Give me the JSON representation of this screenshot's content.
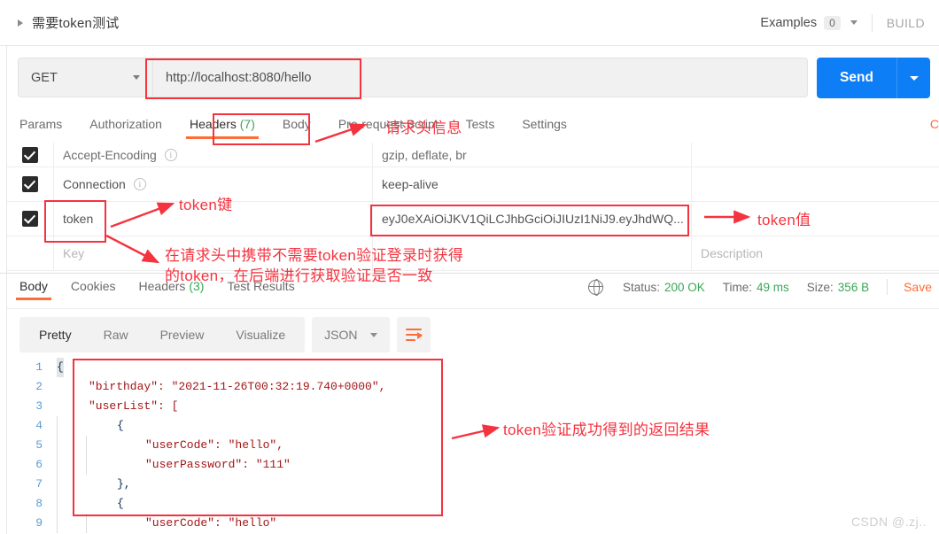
{
  "header": {
    "request_title": "需要token测试",
    "examples_label": "Examples",
    "examples_count": "0",
    "build_label": "BUILD"
  },
  "url_bar": {
    "method": "GET",
    "url": "http://localhost:8080/hello",
    "send_label": "Send"
  },
  "request_tabs": [
    {
      "label": "Params",
      "count": "",
      "active": false
    },
    {
      "label": "Authorization",
      "count": "",
      "active": false
    },
    {
      "label": "Headers",
      "count": "(7)",
      "active": true
    },
    {
      "label": "Body",
      "count": "",
      "active": false
    },
    {
      "label": "Pre-request Script",
      "count": "",
      "active": false
    },
    {
      "label": "Tests",
      "count": "",
      "active": false
    },
    {
      "label": "Settings",
      "count": "",
      "active": false
    }
  ],
  "request_tab_cut_label": "C",
  "headers_table": {
    "rows": [
      {
        "checked": true,
        "key": "Accept-Encoding",
        "has_info": true,
        "value": "gzip, deflate, br",
        "description": ""
      },
      {
        "checked": true,
        "key": "Connection",
        "has_info": true,
        "value": "keep-alive",
        "description": ""
      },
      {
        "checked": true,
        "key": "token",
        "has_info": false,
        "value": "eyJ0eXAiOiJKV1QiLCJhbGciOiJIUzI1NiJ9.eyJhdWQ...",
        "description": ""
      }
    ],
    "new_row": {
      "key_placeholder": "Key",
      "value_placeholder": "",
      "description_placeholder": "Description"
    }
  },
  "response_tabs": [
    {
      "label": "Body",
      "count": "",
      "active": true
    },
    {
      "label": "Cookies",
      "count": "",
      "active": false
    },
    {
      "label": "Headers",
      "count": "(3)",
      "active": false
    },
    {
      "label": "Test Results",
      "count": "",
      "active": false
    }
  ],
  "status_bar": {
    "status_label": "Status:",
    "status_value": "200 OK",
    "time_label": "Time:",
    "time_value": "49 ms",
    "size_label": "Size:",
    "size_value": "356 B",
    "save_label": "Save"
  },
  "viewer_toolbar": {
    "tabs": [
      {
        "label": "Pretty",
        "active": true
      },
      {
        "label": "Raw",
        "active": false
      },
      {
        "label": "Preview",
        "active": false
      },
      {
        "label": "Visualize",
        "active": false
      }
    ],
    "format": "JSON"
  },
  "response_body": {
    "lines": [
      {
        "num": "1",
        "indent": 0,
        "text": "{"
      },
      {
        "num": "2",
        "indent": 1,
        "text": "\"birthday\": \"2021-11-26T00:32:19.740+0000\","
      },
      {
        "num": "3",
        "indent": 1,
        "text": "\"userList\": ["
      },
      {
        "num": "4",
        "indent": 2,
        "text": "{"
      },
      {
        "num": "5",
        "indent": 3,
        "text": "\"userCode\": \"hello\","
      },
      {
        "num": "6",
        "indent": 3,
        "text": "\"userPassword\": \"111\""
      },
      {
        "num": "7",
        "indent": 2,
        "text": "},"
      },
      {
        "num": "8",
        "indent": 2,
        "text": "{"
      },
      {
        "num": "9",
        "indent": 3,
        "text": "\"userCode\": \"hello\""
      }
    ]
  },
  "annotations": {
    "headers_note": "请求头信息",
    "token_key_note": "token键",
    "token_value_note": "token值",
    "token_usage_note_line1": "在请求头中携带不需要token验证登录时获得",
    "token_usage_note_line2": "的token，在后端进行获取验证是否一致",
    "response_note": "token验证成功得到的返回结果"
  },
  "watermark": "CSDN @.zj.."
}
